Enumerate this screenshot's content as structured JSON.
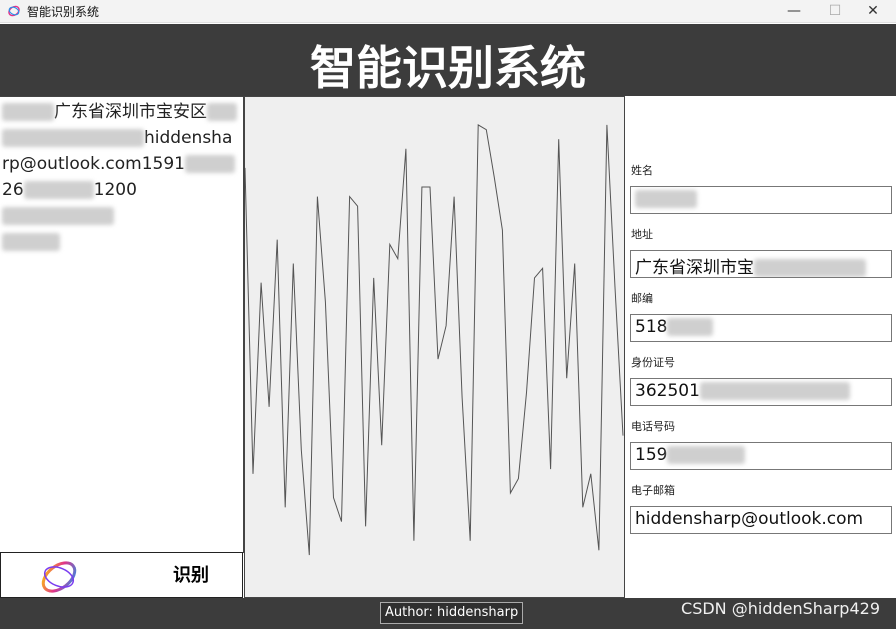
{
  "window": {
    "title": "智能识别系统",
    "minimize": "—",
    "maximize": "☐",
    "close": "✕"
  },
  "header": {
    "title": "智能识别系统"
  },
  "left": {
    "lines": [
      "广东省深圳市宝安区",
      "hiddensha",
      "rp@outlook.com1591",
      "26",
      "1200"
    ],
    "recognize_label": "识别"
  },
  "fields": {
    "name": {
      "label": "姓名",
      "value": ""
    },
    "address": {
      "label": "地址",
      "value": "广东省深圳市宝"
    },
    "postcode": {
      "label": "邮编",
      "value": "518"
    },
    "id_number": {
      "label": "身份证号",
      "value": "362501"
    },
    "phone": {
      "label": "电话号码",
      "value": "159"
    },
    "email": {
      "label": "电子邮箱",
      "value": "hiddensharp@outlook.com"
    }
  },
  "footer": {
    "author": "Author: hiddensharp",
    "watermark": "CSDN @hiddenSharp429"
  },
  "waveform": {
    "values": [
      0.86,
      0.22,
      0.62,
      0.36,
      0.71,
      0.15,
      0.66,
      0.27,
      0.05,
      0.8,
      0.58,
      0.17,
      0.12,
      0.8,
      0.78,
      0.11,
      0.63,
      0.28,
      0.7,
      0.67,
      0.9,
      0.08,
      0.82,
      0.82,
      0.46,
      0.53,
      0.8,
      0.38,
      0.08,
      0.95,
      0.94,
      0.84,
      0.73,
      0.18,
      0.21,
      0.39,
      0.63,
      0.65,
      0.23,
      0.92,
      0.42,
      0.66,
      0.15,
      0.22,
      0.06,
      0.95,
      0.61,
      0.3
    ]
  }
}
